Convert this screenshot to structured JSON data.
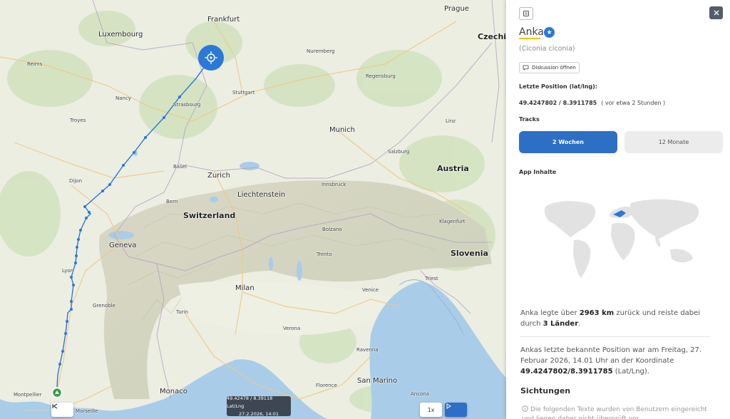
{
  "map": {
    "labels": {
      "frankfurt": "Frankfurt",
      "prague": "Prague",
      "czechia": "Czechia",
      "luxembourg": "Luxembourg",
      "reims": "Reims",
      "nuremberg": "Nuremberg",
      "regensburg": "Regensburg",
      "nancy": "Nancy",
      "stuttgart": "Stuttgart",
      "strasbourg": "Strasbourg",
      "troyes": "Troyes",
      "munich": "Munich",
      "linz": "Linz",
      "salzburg": "Salzburg",
      "basel": "Basel",
      "zurich": "Zurich",
      "austria": "Austria",
      "dijon": "Dijon",
      "liechtenstein": "Liechtenstein",
      "innsbruck": "Innsbruck",
      "bern": "Bern",
      "switzerland": "Switzerland",
      "bolzano": "Bolzano",
      "klagenfurt": "Klagenfurt",
      "geneva": "Geneva",
      "slovenia": "Slovenia",
      "trento": "Trento",
      "lyon": "Lyon",
      "trieste": "Triest",
      "milan": "Milan",
      "venice": "Venice",
      "grenoble": "Grenoble",
      "turin": "Turin",
      "verona": "Verona",
      "ravenna": "Ravenna",
      "monaco": "Monaco",
      "florence": "Florence",
      "sanmarino": "San Marino",
      "montpellier": "Montpellier",
      "marseille": "Marseille",
      "ancona": "Ancona"
    },
    "tooltip": {
      "coords": "49.42478 / 8.39118 Lat/Lng",
      "time": "27.2.2026, 14:01"
    },
    "controls": {
      "back_icon": "skip-back-icon",
      "speed_label": "1x",
      "play_icon": "play-icon"
    }
  },
  "panel": {
    "title": "Anka",
    "scientific_name": "(Ciconia ciconia)",
    "discussion_button": "Diskussion öffnen",
    "last_position_label": "Letzte Position (lat/lng):",
    "last_position_value": "49.4247802 / 8.3911785",
    "last_position_ago": "( vor etwa 2 Stunden )",
    "tracks_label": "Tracks",
    "tab_active": "2 Wochen",
    "tab_inactive": "12 Monate",
    "app_content_label": "App Inhalte",
    "stats_1": "Anka legte über ",
    "stats_distance": "2963 km",
    "stats_2": " zurück und reiste dabei durch ",
    "stats_countries": "3 Länder",
    "stats_3": ".",
    "last_known_1": "Ankas letzte bekannte Position war am Freitag, 27. Februar 2026, 14.01 Uhr an der Koordinate ",
    "last_known_coords": "49.4247802/8.3911785",
    "last_known_2": " (Lat/Lng).",
    "sightings_heading": "Sichtungen",
    "sightings_note": "Die folgenden Texte wurden von Benutzern eingereicht und liegen daher nicht überprüft vor.",
    "icons": {
      "top_left": "layout-icon",
      "close": "close-icon",
      "verified": "verified-star-icon",
      "chat": "chat-icon",
      "info": "info-icon"
    }
  },
  "colors": {
    "track": "#2a78d8",
    "accent": "#2d6fc4",
    "underline": "#f4c300",
    "tooltip_bg": "#3d4754"
  }
}
